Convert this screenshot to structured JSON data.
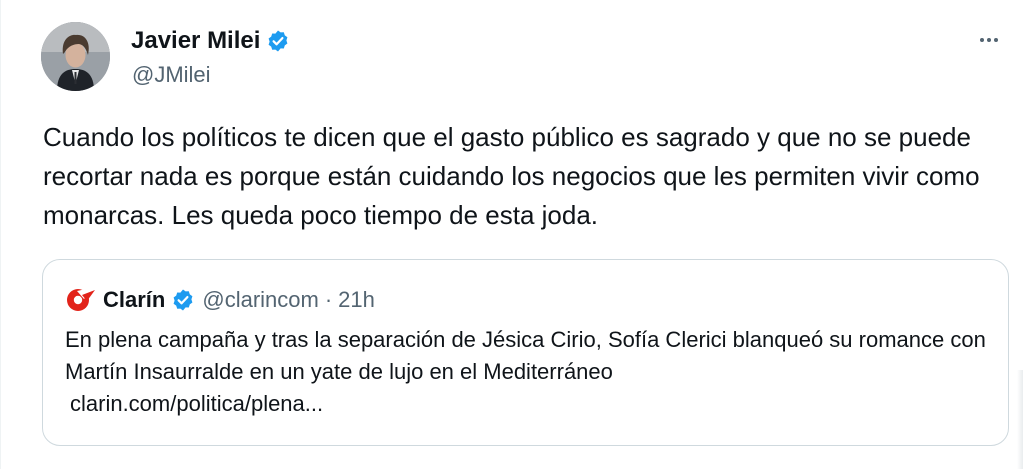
{
  "author": {
    "name": "Javier Milei",
    "handle": "@JMilei",
    "verified_icon": "verified-badge-icon"
  },
  "tweet": {
    "text": "Cuando los políticos te dicen que el gasto público es sagrado y que no se puede recortar nada es porque están cuidando los negocios que les permiten vivir como monarcas. Les queda poco tiempo de esta joda."
  },
  "quote": {
    "name": "Clarín",
    "handle": "@clarincom",
    "separator": "·",
    "time": "21h",
    "text": "En plena campaña y tras la separación de Jésica Cirio, Sofía Clerici blanqueó su romance con Martín Insaurralde en un yate de lujo en el Mediterráneo",
    "link": "clarin.com/politica/plena..."
  },
  "colors": {
    "verified": "#1d9bf0",
    "clarin_brand": "#e2231a",
    "secondary_text": "#536471",
    "border": "#cfd9de"
  }
}
